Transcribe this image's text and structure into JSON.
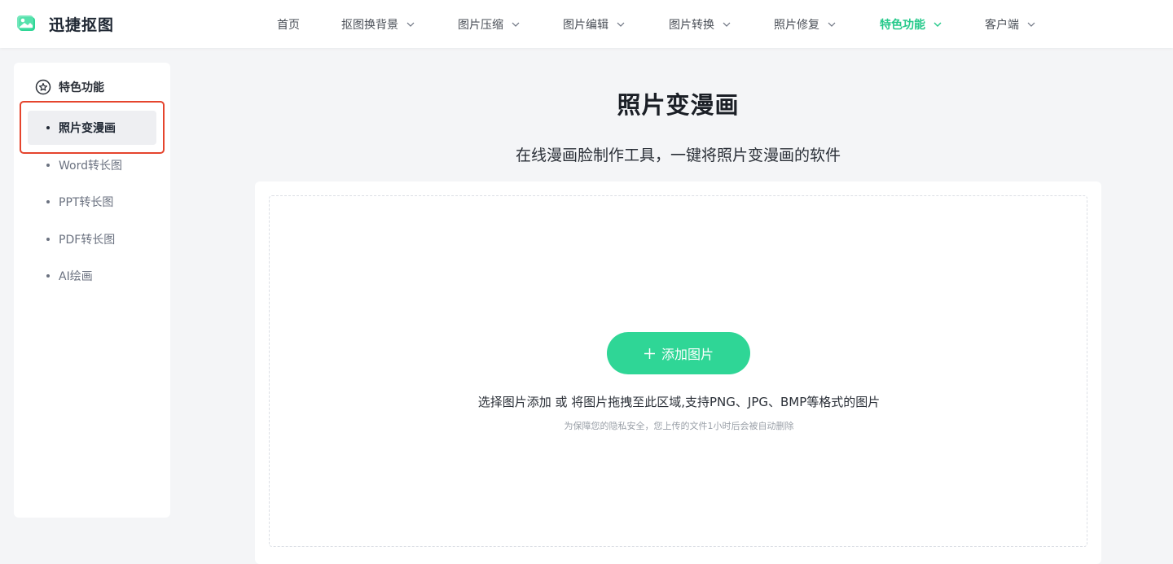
{
  "brand": {
    "name": "迅捷抠图",
    "logo_icon": "image-logo-icon",
    "accent_color": "#2fd696"
  },
  "nav": {
    "items": [
      {
        "label": "首页",
        "has_dropdown": false,
        "active": false
      },
      {
        "label": "抠图换背景",
        "has_dropdown": true,
        "active": false
      },
      {
        "label": "图片压缩",
        "has_dropdown": true,
        "active": false
      },
      {
        "label": "图片编辑",
        "has_dropdown": true,
        "active": false
      },
      {
        "label": "图片转换",
        "has_dropdown": true,
        "active": false
      },
      {
        "label": "照片修复",
        "has_dropdown": true,
        "active": false
      },
      {
        "label": "特色功能",
        "has_dropdown": true,
        "active": true
      },
      {
        "label": "客户端",
        "has_dropdown": true,
        "active": false
      }
    ]
  },
  "sidebar": {
    "heading": "特色功能",
    "heading_icon": "star-circle-icon",
    "items": [
      {
        "label": "照片变漫画",
        "active": true
      },
      {
        "label": "Word转长图",
        "active": false
      },
      {
        "label": "PPT转长图",
        "active": false
      },
      {
        "label": "PDF转长图",
        "active": false
      },
      {
        "label": "AI绘画",
        "active": false
      }
    ],
    "highlight_color": "#e5442d"
  },
  "main": {
    "title": "照片变漫画",
    "subtitle": "在线漫画脸制作工具，一键将照片变漫画的软件",
    "upload": {
      "button_label": "添加图片",
      "button_icon": "plus-icon",
      "hint": "选择图片添加 或 将图片拖拽至此区域,支持PNG、JPG、BMP等格式的图片",
      "privacy_note": "为保障您的隐私安全，您上传的文件1小时后会被自动删除"
    }
  }
}
